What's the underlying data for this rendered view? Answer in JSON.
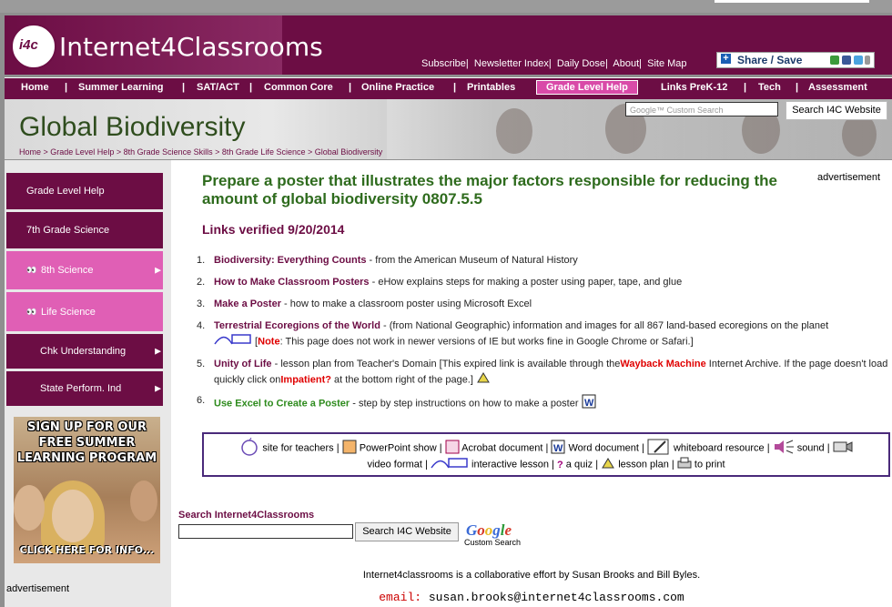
{
  "header": {
    "logo_badge": "i4c",
    "logo_text": "Internet4Classrooms",
    "top_links": [
      "Subscribe",
      "Newsletter Index",
      "Daily Dose",
      "About",
      "Site Map"
    ],
    "share_label": "Share / Save"
  },
  "nav": [
    "Home",
    "Summer Learning",
    "SAT/ACT",
    "Common Core",
    "Online Practice",
    "Printables",
    "Grade Level Help",
    "Links PreK-12",
    "Tech",
    "Assessment"
  ],
  "banner": {
    "title": "Global Biodiversity",
    "search_placeholder": "Google™ Custom Search",
    "search_button": "Search I4C Website",
    "breadcrumb": [
      "Home",
      "Grade Level Help",
      "8th Grade Science Skills",
      "8th Grade Life Science",
      "Global Biodiversity"
    ],
    "breadcrumb_sep": " > "
  },
  "sidebar": {
    "items": [
      {
        "label": "Grade Level Help"
      },
      {
        "label": "7th Grade Science"
      },
      {
        "label": "8th Science"
      },
      {
        "label": "Life Science"
      },
      {
        "label": "Chk Understanding"
      },
      {
        "label": "State Perform. Ind"
      }
    ],
    "promo": {
      "line1": "SIGN UP FOR OUR",
      "line2": "FREE SUMMER",
      "line3": "LEARNING PROGRAM",
      "cta": "CLICK HERE FOR INFO..."
    },
    "advertisement": "advertisement"
  },
  "main": {
    "headline": "Prepare a poster that illustrates the major factors responsible for reducing the amount of global biodiversity 0807.5.5",
    "advertisement": "advertisement",
    "verified": "Links verified 9/20/2014",
    "items": [
      {
        "num": "1.",
        "link": "Biodiversity: Everything Counts",
        "text": " - from the American Museum of Natural History"
      },
      {
        "num": "2.",
        "link": "How to Make Classroom Posters",
        "text": " - eHow explains steps for making a poster using paper, tape, and glue"
      },
      {
        "num": "3.",
        "link": "Make a Poster",
        "text": " - how to make a classroom poster using Microsoft Excel"
      },
      {
        "num": "4.",
        "link": "Terrestrial Ecoregions of the World",
        "text": " - (from National Geographic) information and images for all 867 land-based ecoregions on the planet",
        "note_label": "Note",
        "note_text": ": This page does not work in newer versions of IE but works fine in Google Chrome or Safari.]"
      },
      {
        "num": "5.",
        "link": "Unity of Life",
        "text": " - lesson plan from Teacher's Domain [This expired link is available through the",
        "wayback": "Wayback Machine",
        "text2": " Internet Archive. If the page doesn't load quickly click on",
        "impatient": "Impatient?",
        "text3": " at the bottom right of the page.]"
      },
      {
        "num": "6.",
        "link": "Use Excel to Create a Poster",
        "text": " - step by step instructions on how to make a poster"
      }
    ],
    "legend": {
      "row1": [
        "site for teachers",
        "PowerPoint show",
        "Acrobat document",
        "Word document",
        "whiteboard resource",
        "sound"
      ],
      "row2": [
        "video format",
        "interactive lesson",
        "a quiz",
        "lesson plan",
        "to print"
      ]
    },
    "search_label": "Search Internet4Classrooms",
    "search_button": "Search I4C Website",
    "google_logo": "Google",
    "google_sub": "Custom Search",
    "footer_text": "Internet4classrooms is a collaborative effort by Susan Brooks and Bill Byles.",
    "email_label": "email:",
    "email": "susan.brooks@internet4classrooms.com"
  },
  "colors": {
    "brand": "#6c0d44",
    "accent_pink": "#e05fb5",
    "headline_green": "#2e6b1d"
  }
}
